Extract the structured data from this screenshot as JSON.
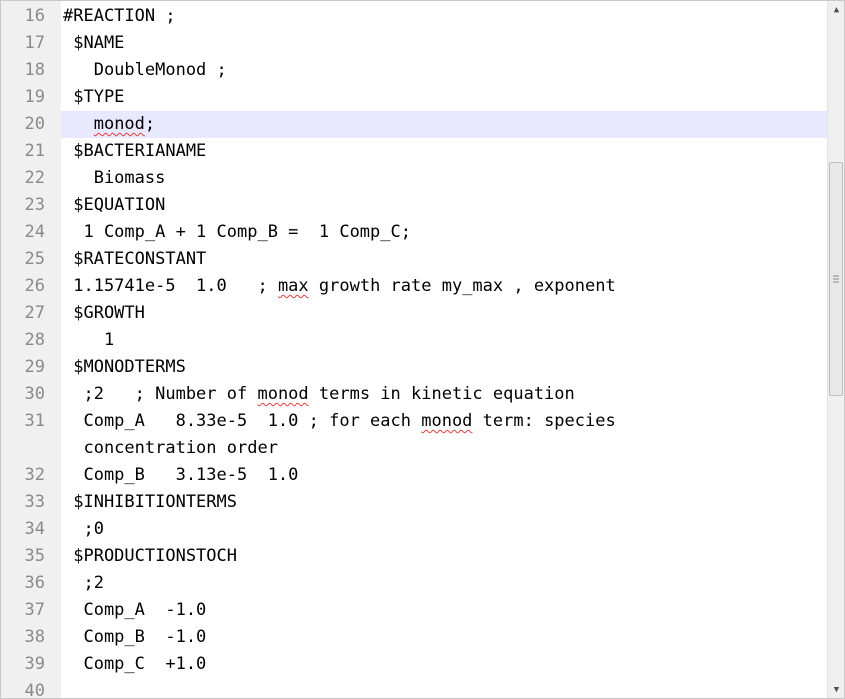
{
  "editor": {
    "lines": [
      {
        "num": "16",
        "text": "#REACTION ;"
      },
      {
        "num": "17",
        "text": " $NAME"
      },
      {
        "num": "18",
        "text": "   DoubleMonod ;"
      },
      {
        "num": "19",
        "text": " $TYPE"
      },
      {
        "num": "20",
        "text": "   monod;",
        "current": true,
        "spell_word": "monod",
        "before": "   ",
        "after": ";"
      },
      {
        "num": "21",
        "text": " $BACTERIANAME"
      },
      {
        "num": "22",
        "text": "   Biomass"
      },
      {
        "num": "23",
        "text": " $EQUATION"
      },
      {
        "num": "24",
        "text": "  1 Comp_A + 1 Comp_B =  1 Comp_C;"
      },
      {
        "num": "25",
        "text": " $RATECONSTANT"
      },
      {
        "num": "26",
        "text": " 1.15741e-5  1.0   ; max growth rate my_max , exponent",
        "spell_word": "max",
        "before": " 1.15741e-5  1.0   ; ",
        "after": " growth rate my_max , exponent"
      },
      {
        "num": "27",
        "text": " $GROWTH"
      },
      {
        "num": "28",
        "text": "    1"
      },
      {
        "num": "29",
        "text": " $MONODTERMS"
      },
      {
        "num": "30",
        "text": "  ;2   ; Number of monod terms in kinetic equation",
        "spell_word": "monod",
        "before": "  ;2   ; Number of ",
        "after": " terms in kinetic equation"
      },
      {
        "num": "31",
        "text": "  Comp_A   8.33e-5  1.0 ; for each monod term: species",
        "wrapped": "  concentration order",
        "spell_word": "monod",
        "before": "  Comp_A   8.33e-5  1.0 ; for each ",
        "after": " term: species"
      },
      {
        "num": "32",
        "text": "  Comp_B   3.13e-5  1.0"
      },
      {
        "num": "33",
        "text": " $INHIBITIONTERMS"
      },
      {
        "num": "34",
        "text": "  ;0"
      },
      {
        "num": "35",
        "text": " $PRODUCTIONSTOCH"
      },
      {
        "num": "36",
        "text": "  ;2"
      },
      {
        "num": "37",
        "text": "  Comp_A  -1.0"
      },
      {
        "num": "38",
        "text": "  Comp_B  -1.0"
      },
      {
        "num": "39",
        "text": "  Comp_C  +1.0"
      },
      {
        "num": "40",
        "text": ""
      }
    ]
  },
  "scrollbar": {
    "up_icon": "arrow-up-icon",
    "down_icon": "arrow-down-icon"
  },
  "colors": {
    "gutter_bg": "#f0f0f0",
    "line_number": "#8a8a8a",
    "current_line": "#e8e8ff",
    "spell_underline": "#e0403c"
  }
}
